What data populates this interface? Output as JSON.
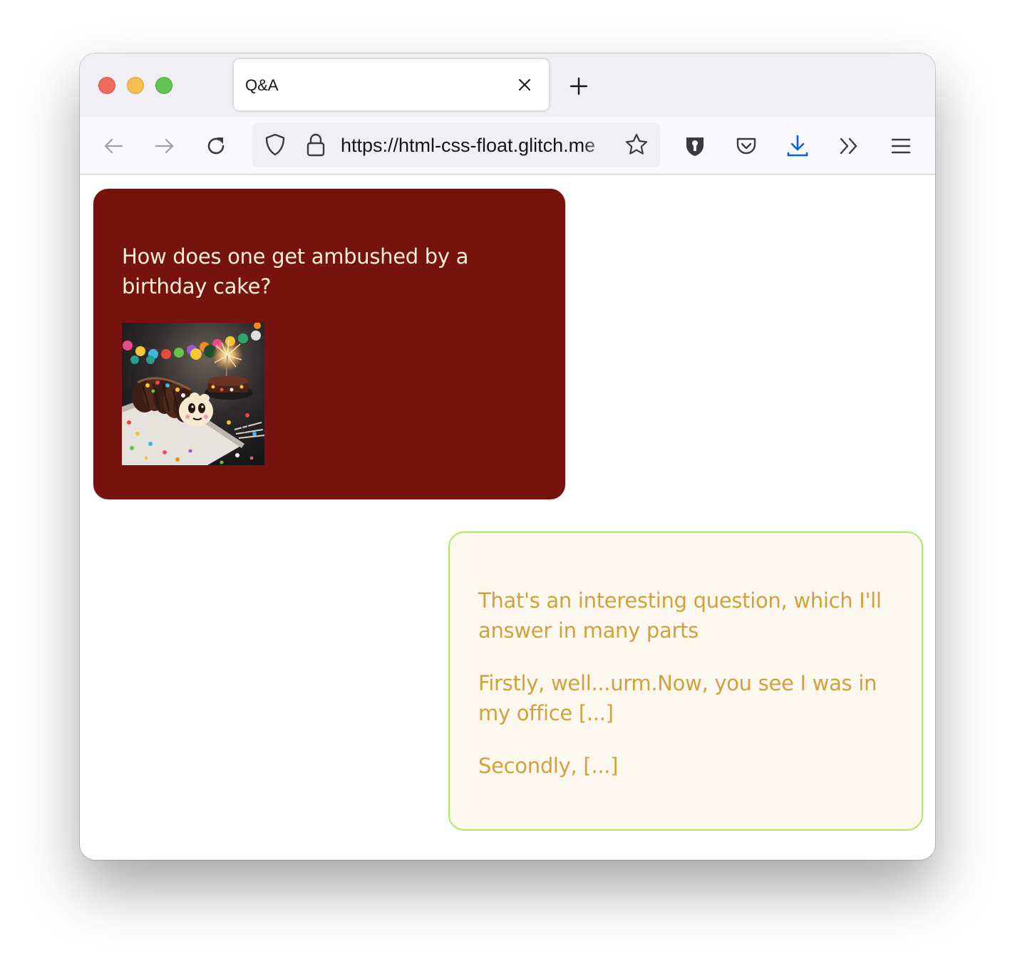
{
  "browser": {
    "tab": {
      "title": "Q&A"
    },
    "url": "https://html-css-float.glitch.me",
    "icons": {
      "back": "back-arrow-icon",
      "forward": "forward-arrow-icon",
      "reload": "reload-icon",
      "shield": "tracking-shield-icon",
      "lock": "lock-icon",
      "bookmark": "bookmark-star-icon",
      "extension": "password-manager-icon",
      "pocket": "pocket-icon",
      "download": "download-icon",
      "overflow": "overflow-chevrons-icon",
      "menu": "hamburger-menu-icon"
    }
  },
  "page": {
    "question": {
      "text": "How does one get ambushed by a birthday cake?",
      "background": "#76130e",
      "text_color": "#fbeedc"
    },
    "answer": {
      "paragraphs": [
        "That's an interesting question, which I'll answer in many parts",
        "Firstly, well...urm.Now, you see I was in my office [...]",
        "Secondly, [...]"
      ],
      "background": "#fcf8f0",
      "border_color": "#a5ef5c",
      "text_color": "#d0a23c"
    }
  }
}
